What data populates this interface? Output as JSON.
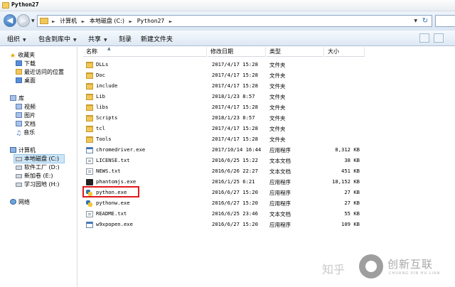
{
  "window": {
    "title": "Python27"
  },
  "address": {
    "crumbs": [
      "计算机",
      "本地磁盘 (C:)",
      "Python27"
    ]
  },
  "toolbar": {
    "organize": "组织",
    "include_in_library": "包含到库中",
    "share": "共享",
    "burn": "刻录",
    "new_folder": "新建文件夹"
  },
  "sidebar": {
    "favorites": {
      "label": "收藏夹",
      "items": [
        "下载",
        "最近访问的位置",
        "桌面"
      ]
    },
    "libraries": {
      "label": "库",
      "items": [
        "视频",
        "图片",
        "文档",
        "音乐"
      ]
    },
    "computer": {
      "label": "计算机",
      "items": [
        "本地磁盘 (C:)",
        "软件工厂 (D:)",
        "新加卷 (E:)",
        "学习园地 (H:)"
      ]
    },
    "network": {
      "label": "网络"
    }
  },
  "columns": {
    "name": "名称",
    "modified": "修改日期",
    "type": "类型",
    "size": "大小"
  },
  "files": [
    {
      "name": "DLLs",
      "date": "2017/4/17 15:28",
      "type": "文件夹",
      "size": "",
      "icon": "folder-icon"
    },
    {
      "name": "Doc",
      "date": "2017/4/17 15:28",
      "type": "文件夹",
      "size": "",
      "icon": "folder-icon"
    },
    {
      "name": "include",
      "date": "2017/4/17 15:28",
      "type": "文件夹",
      "size": "",
      "icon": "folder-icon"
    },
    {
      "name": "Lib",
      "date": "2018/1/23 8:57",
      "type": "文件夹",
      "size": "",
      "icon": "folder-icon"
    },
    {
      "name": "libs",
      "date": "2017/4/17 15:28",
      "type": "文件夹",
      "size": "",
      "icon": "folder-icon"
    },
    {
      "name": "Scripts",
      "date": "2018/1/23 8:57",
      "type": "文件夹",
      "size": "",
      "icon": "folder-icon"
    },
    {
      "name": "tcl",
      "date": "2017/4/17 15:28",
      "type": "文件夹",
      "size": "",
      "icon": "folder-icon"
    },
    {
      "name": "Tools",
      "date": "2017/4/17 15:28",
      "type": "文件夹",
      "size": "",
      "icon": "folder-icon"
    },
    {
      "name": "chromedriver.exe",
      "date": "2017/10/14 16:44",
      "type": "应用程序",
      "size": "8,312 KB",
      "icon": "app-icon"
    },
    {
      "name": "LICENSE.txt",
      "date": "2016/6/25 15:22",
      "type": "文本文档",
      "size": "38 KB",
      "icon": "text-file-icon"
    },
    {
      "name": "NEWS.txt",
      "date": "2016/6/26 22:27",
      "type": "文本文档",
      "size": "451 KB",
      "icon": "text-file-icon"
    },
    {
      "name": "phantomjs.exe",
      "date": "2016/1/25 6:21",
      "type": "应用程序",
      "size": "18,152 KB",
      "icon": "phantomjs-icon"
    },
    {
      "name": "python.exe",
      "date": "2016/6/27 15:20",
      "type": "应用程序",
      "size": "27 KB",
      "icon": "python-icon"
    },
    {
      "name": "pythonw.exe",
      "date": "2016/6/27 15:20",
      "type": "应用程序",
      "size": "27 KB",
      "icon": "python-icon"
    },
    {
      "name": "README.txt",
      "date": "2016/6/25 23:46",
      "type": "文本文档",
      "size": "55 KB",
      "icon": "text-file-icon"
    },
    {
      "name": "w9xpopen.exe",
      "date": "2016/6/27 15:20",
      "type": "应用程序",
      "size": "109 KB",
      "icon": "app-icon"
    }
  ],
  "watermark": {
    "zhihu": "知乎",
    "brand": "创新互联",
    "brand_sub": "CHUANG XIN HU LIAN"
  }
}
